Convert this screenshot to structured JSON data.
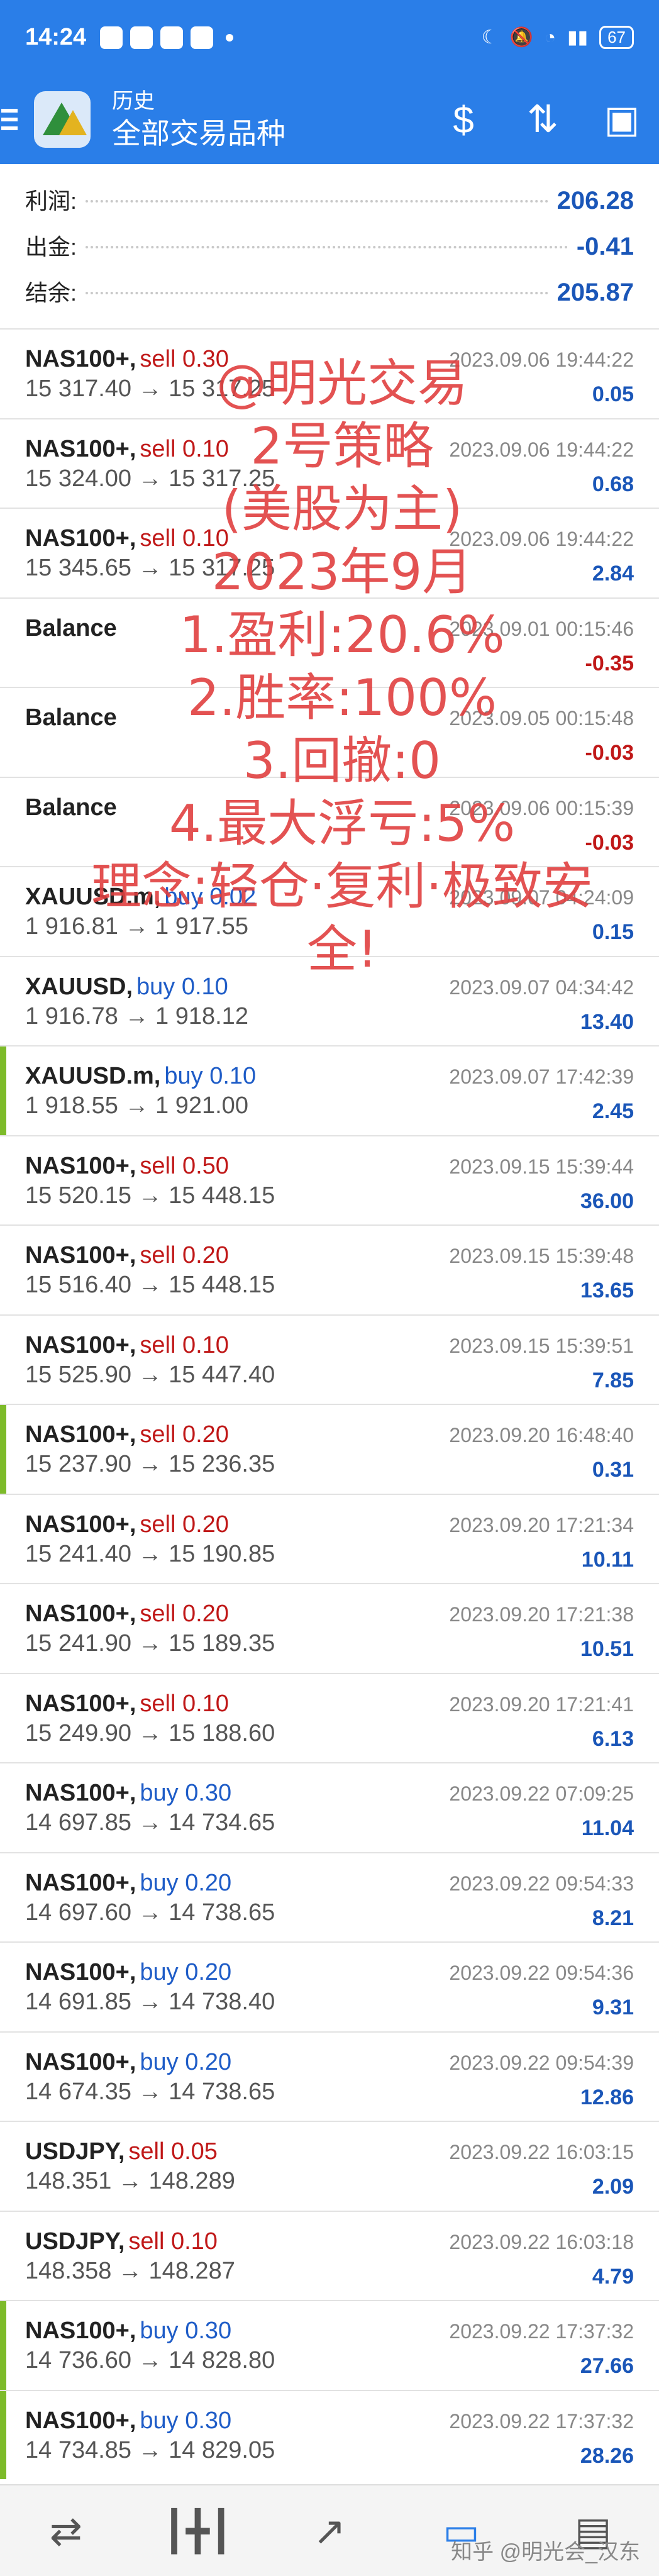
{
  "status_bar": {
    "time": "14:24",
    "battery": "67"
  },
  "header": {
    "subtitle": "历史",
    "title": "全部交易品种"
  },
  "summary": {
    "profit_label": "利润:",
    "profit_value": "206.28",
    "withdraw_label": "出金:",
    "withdraw_value": "-0.41",
    "balance_label": "结余:",
    "balance_value": "205.87"
  },
  "trades": [
    {
      "symbol": "NAS100+,",
      "side": "sell 0.30",
      "type": "sell",
      "prices": "15 317.40 → 15 317.25",
      "time": "2023.09.06 19:44:22",
      "profit": "0.05",
      "neg": false,
      "bar": false
    },
    {
      "symbol": "NAS100+,",
      "side": "sell 0.10",
      "type": "sell",
      "prices": "15 324.00 → 15 317.25",
      "time": "2023.09.06 19:44:22",
      "profit": "0.68",
      "neg": false,
      "bar": false
    },
    {
      "symbol": "NAS100+,",
      "side": "sell 0.10",
      "type": "sell",
      "prices": "15 345.65 → 15 317.25",
      "time": "2023.09.06 19:44:22",
      "profit": "2.84",
      "neg": false,
      "bar": false
    },
    {
      "symbol": "Balance",
      "side": "",
      "type": "",
      "prices": "",
      "time": "2023.09.01 00:15:46",
      "profit": "-0.35",
      "neg": true,
      "bar": false
    },
    {
      "symbol": "Balance",
      "side": "",
      "type": "",
      "prices": "",
      "time": "2023.09.05 00:15:48",
      "profit": "-0.03",
      "neg": true,
      "bar": false
    },
    {
      "symbol": "Balance",
      "side": "",
      "type": "",
      "prices": "",
      "time": "2023.09.06 00:15:39",
      "profit": "-0.03",
      "neg": true,
      "bar": false
    },
    {
      "symbol": "XAUUSD.m,",
      "side": "buy 0.02",
      "type": "buy",
      "prices": "1 916.81 → 1 917.55",
      "time": "2023.09.07 04:24:09",
      "profit": "0.15",
      "neg": false,
      "bar": false
    },
    {
      "symbol": "XAUUSD,",
      "side": "buy 0.10",
      "type": "buy",
      "prices": "1 916.78 → 1 918.12",
      "time": "2023.09.07 04:34:42",
      "profit": "13.40",
      "neg": false,
      "bar": false
    },
    {
      "symbol": "XAUUSD.m,",
      "side": "buy 0.10",
      "type": "buy",
      "prices": "1 918.55 → 1 921.00",
      "time": "2023.09.07 17:42:39",
      "profit": "2.45",
      "neg": false,
      "bar": true
    },
    {
      "symbol": "NAS100+,",
      "side": "sell 0.50",
      "type": "sell",
      "prices": "15 520.15 → 15 448.15",
      "time": "2023.09.15 15:39:44",
      "profit": "36.00",
      "neg": false,
      "bar": false
    },
    {
      "symbol": "NAS100+,",
      "side": "sell 0.20",
      "type": "sell",
      "prices": "15 516.40 → 15 448.15",
      "time": "2023.09.15 15:39:48",
      "profit": "13.65",
      "neg": false,
      "bar": false
    },
    {
      "symbol": "NAS100+,",
      "side": "sell 0.10",
      "type": "sell",
      "prices": "15 525.90 → 15 447.40",
      "time": "2023.09.15 15:39:51",
      "profit": "7.85",
      "neg": false,
      "bar": false
    },
    {
      "symbol": "NAS100+,",
      "side": "sell 0.20",
      "type": "sell",
      "prices": "15 237.90 → 15 236.35",
      "time": "2023.09.20 16:48:40",
      "profit": "0.31",
      "neg": false,
      "bar": true
    },
    {
      "symbol": "NAS100+,",
      "side": "sell 0.20",
      "type": "sell",
      "prices": "15 241.40 → 15 190.85",
      "time": "2023.09.20 17:21:34",
      "profit": "10.11",
      "neg": false,
      "bar": false
    },
    {
      "symbol": "NAS100+,",
      "side": "sell 0.20",
      "type": "sell",
      "prices": "15 241.90 → 15 189.35",
      "time": "2023.09.20 17:21:38",
      "profit": "10.51",
      "neg": false,
      "bar": false
    },
    {
      "symbol": "NAS100+,",
      "side": "sell 0.10",
      "type": "sell",
      "prices": "15 249.90 → 15 188.60",
      "time": "2023.09.20 17:21:41",
      "profit": "6.13",
      "neg": false,
      "bar": false
    },
    {
      "symbol": "NAS100+,",
      "side": "buy 0.30",
      "type": "buy",
      "prices": "14 697.85 → 14 734.65",
      "time": "2023.09.22 07:09:25",
      "profit": "11.04",
      "neg": false,
      "bar": false
    },
    {
      "symbol": "NAS100+,",
      "side": "buy 0.20",
      "type": "buy",
      "prices": "14 697.60 → 14 738.65",
      "time": "2023.09.22 09:54:33",
      "profit": "8.21",
      "neg": false,
      "bar": false
    },
    {
      "symbol": "NAS100+,",
      "side": "buy 0.20",
      "type": "buy",
      "prices": "14 691.85 → 14 738.40",
      "time": "2023.09.22 09:54:36",
      "profit": "9.31",
      "neg": false,
      "bar": false
    },
    {
      "symbol": "NAS100+,",
      "side": "buy 0.20",
      "type": "buy",
      "prices": "14 674.35 → 14 738.65",
      "time": "2023.09.22 09:54:39",
      "profit": "12.86",
      "neg": false,
      "bar": false
    },
    {
      "symbol": "USDJPY,",
      "side": "sell 0.05",
      "type": "sell",
      "prices": "148.351 → 148.289",
      "time": "2023.09.22 16:03:15",
      "profit": "2.09",
      "neg": false,
      "bar": false
    },
    {
      "symbol": "USDJPY,",
      "side": "sell 0.10",
      "type": "sell",
      "prices": "148.358 → 148.287",
      "time": "2023.09.22 16:03:18",
      "profit": "4.79",
      "neg": false,
      "bar": false
    },
    {
      "symbol": "NAS100+,",
      "side": "buy 0.30",
      "type": "buy",
      "prices": "14 736.60 → 14 828.80",
      "time": "2023.09.22 17:37:32",
      "profit": "27.66",
      "neg": false,
      "bar": true
    },
    {
      "symbol": "NAS100+,",
      "side": "buy 0.30",
      "type": "buy",
      "prices": "14 734.85 → 14 829.05",
      "time": "2023.09.22 17:37:32",
      "profit": "28.26",
      "neg": false,
      "bar": true
    }
  ],
  "overlay": {
    "lines": [
      "@明光交易",
      "2号策略",
      "(美股为主)",
      "2023年9月",
      "1.盈利:20.6%",
      "2.胜率:100%",
      "3.回撤:0",
      "4.最大浮亏:5%",
      "理念:轻仓·复利·极致安",
      "全!"
    ]
  },
  "footer": {
    "credit": "知乎 @明光会_汉东"
  },
  "icons": {
    "menu": "menu-icon",
    "currency": "dollar-sign-icon",
    "sort": "sort-icon",
    "report": "report-icon",
    "nav": [
      "quotes-icon",
      "chart-candles-icon",
      "trade-icon",
      "history-icon",
      "messages-icon"
    ]
  }
}
